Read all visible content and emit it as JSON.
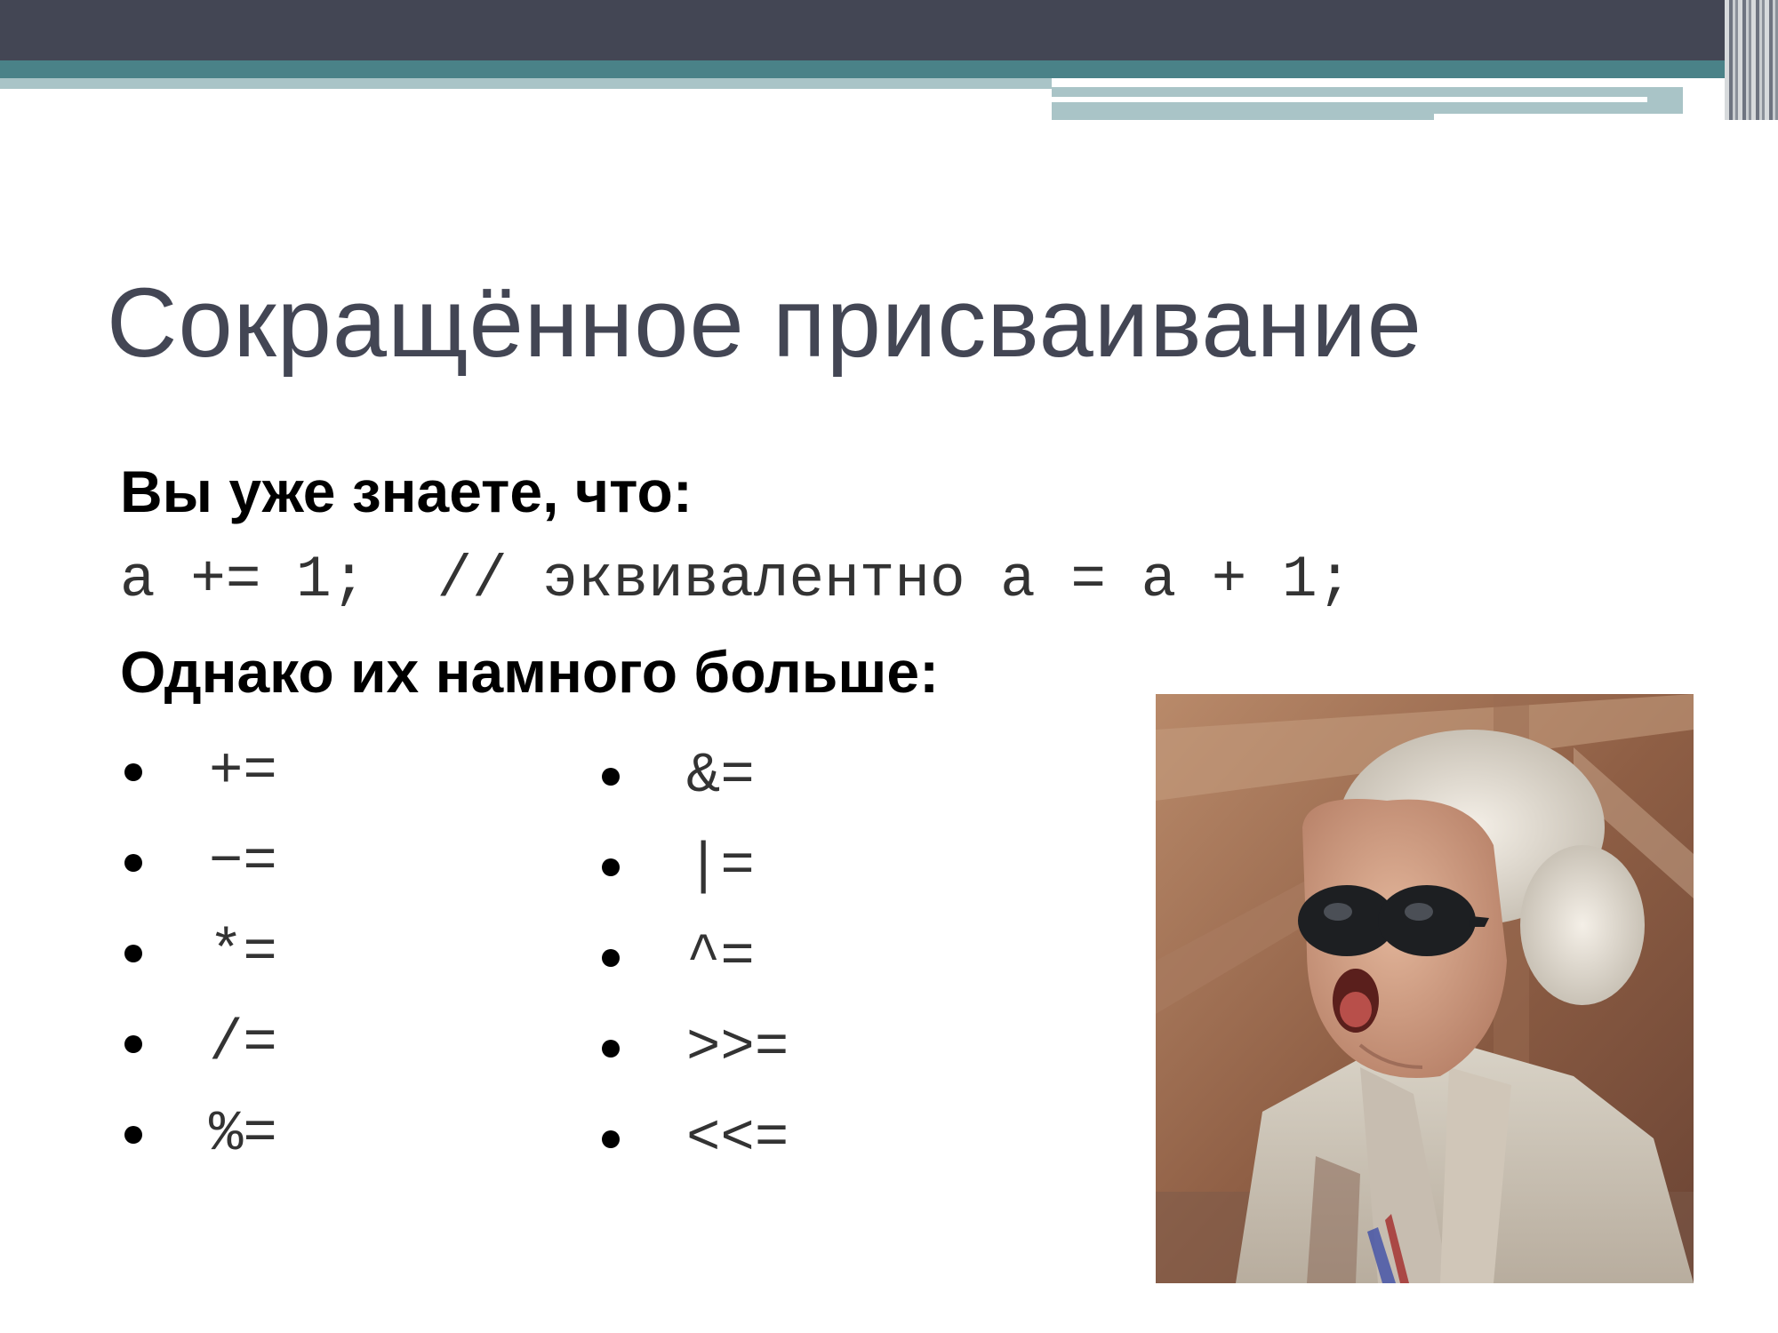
{
  "slide": {
    "title": "Сокращённое присваивание",
    "heading_known": "Вы уже знаете, что:",
    "code_example": "a += 1;  // эквивалентно a = a + 1;",
    "heading_more": "Однако их намного больше:",
    "operators_left": [
      "+=",
      "−=",
      "*=",
      "/=",
      "%="
    ],
    "operators_right": [
      "&=",
      "|=",
      "^=",
      ">>=",
      "<<="
    ]
  },
  "colors": {
    "title": "#434654",
    "header_dark": "#434654",
    "header_teal": "#4a8288",
    "header_light": "#a9c4c7"
  }
}
